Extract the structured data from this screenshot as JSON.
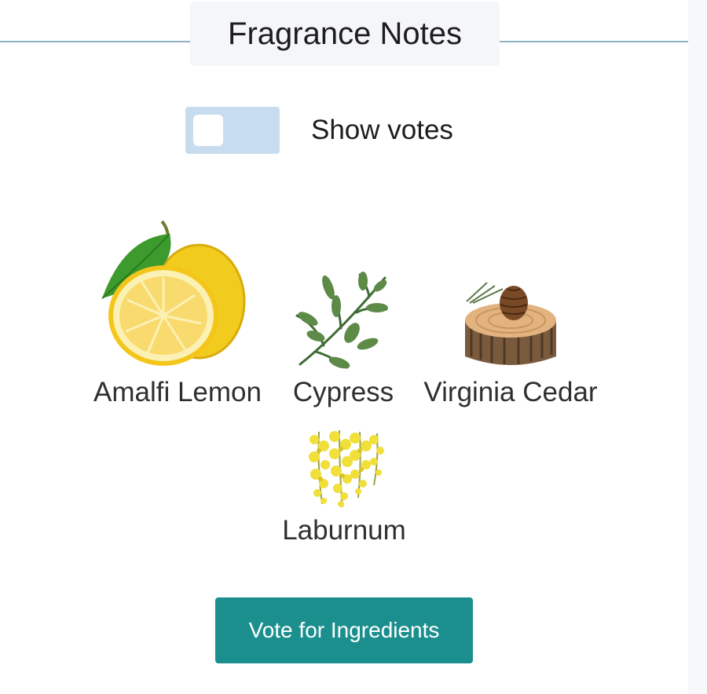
{
  "header": {
    "title": "Fragrance Notes"
  },
  "votes_toggle": {
    "label": "Show votes",
    "enabled": false
  },
  "notes": [
    {
      "name": "Amalfi Lemon",
      "icon": "lemon-icon"
    },
    {
      "name": "Cypress",
      "icon": "cypress-icon"
    },
    {
      "name": "Virginia Cedar",
      "icon": "cedar-icon"
    },
    {
      "name": "Laburnum",
      "icon": "laburnum-icon"
    }
  ],
  "vote_button": {
    "label": "Vote for Ingredients"
  },
  "colors": {
    "accent": "#1b8f8d",
    "divider": "#8fb3c0",
    "toggle_track": "#c7ddef",
    "title_bg": "#f5f6fa"
  }
}
